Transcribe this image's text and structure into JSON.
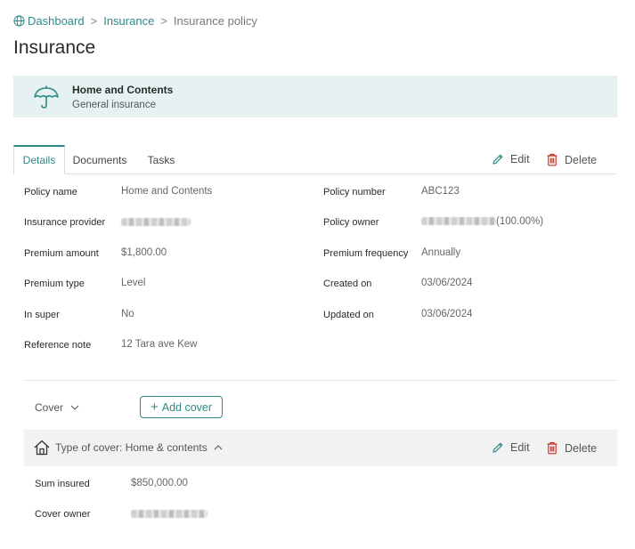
{
  "breadcrumb": {
    "items": [
      "Dashboard",
      "Insurance",
      "Insurance policy"
    ],
    "separator": ">"
  },
  "page": {
    "title": "Insurance"
  },
  "banner": {
    "name": "Home and Contents",
    "type": "General insurance",
    "icon": "umbrella-icon"
  },
  "tabs": [
    "Details",
    "Documents",
    "Tasks"
  ],
  "actions": {
    "edit": "Edit",
    "delete": "Delete"
  },
  "details": {
    "policy_name": {
      "label": "Policy name",
      "value": "Home and Contents"
    },
    "insurance_provider": {
      "label": "Insurance provider",
      "value": ""
    },
    "premium_amount": {
      "label": "Premium amount",
      "value": "$1,800.00"
    },
    "premium_type": {
      "label": "Premium type",
      "value": "Level"
    },
    "in_super": {
      "label": "In super",
      "value": "No"
    },
    "reference_note": {
      "label": "Reference note",
      "value": "12 Tara ave Kew"
    },
    "policy_number": {
      "label": "Policy number",
      "value": "ABC123"
    },
    "policy_owner": {
      "label": "Policy owner",
      "value": "(100.00%)"
    },
    "premium_frequency": {
      "label": "Premium frequency",
      "value": "Annually"
    },
    "created_on": {
      "label": "Created on",
      "value": "03/06/2024"
    },
    "updated_on": {
      "label": "Updated on",
      "value": "03/06/2024"
    }
  },
  "cover": {
    "toggle_label": "Cover",
    "add_label": "Add cover",
    "type_label": "Type of cover: Home & contents",
    "sum_insured": {
      "label": "Sum insured",
      "value": "$850,000.00"
    },
    "cover_owner": {
      "label": "Cover owner",
      "value": ""
    }
  },
  "colors": {
    "accent": "#2f8a87",
    "banner_bg": "#e5f2f1",
    "delete_icon": "#c0392b",
    "cover_bar_bg": "#f2f2f2"
  }
}
